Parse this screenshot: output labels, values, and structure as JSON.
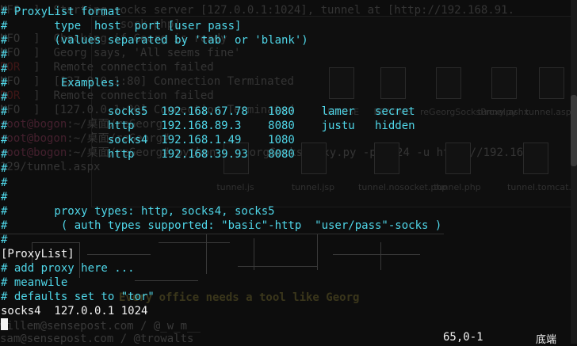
{
  "background_lines": [
    {
      "prefix": "NFO",
      "sep": "  ]  ",
      "text": "Starting socks server [127.0.0.1:1024], tunnel at [http://192.168.91."
    },
    {
      "prefix": "",
      "sep": "",
      "text": "                  sock.php]"
    },
    {
      "prefix": "NFO",
      "sep": "  ]  ",
      "text": "Checking if Georg is ready"
    },
    {
      "prefix": "NFO",
      "sep": "  ]  ",
      "text": "Georg says, 'All seems fine'"
    },
    {
      "prefix": "ROR",
      "sep": "  ]  ",
      "text": "Remote connection failed"
    },
    {
      "prefix": "NFO",
      "sep": "  ]  ",
      "text": "[127.0.0.1:80] Connection Terminated"
    },
    {
      "prefix": "ROR",
      "sep": "  ]  ",
      "text": "Remote connection failed"
    },
    {
      "prefix": "NFO",
      "sep": "  ]  ",
      "text": "[127.0.0.1:80] Connection Terminated"
    },
    {
      "prefix": "root@bogon",
      "sep": ":~/桌面/",
      "text": "reGeorg"
    },
    {
      "prefix": "root@bogon",
      "sep": ":~/桌面/",
      "text": "reGeorg#"
    },
    {
      "prefix": "root@bogon",
      "sep": ":~/桌面/",
      "text": "reGeorg# python reGeorgSocksProxy.py -p 1024 -u http://192.168"
    },
    {
      "prefix": "",
      "sep": "",
      "text": "129/tunnel.aspx"
    }
  ],
  "background_files": [
    "LICENSE",
    "README",
    "reGeorgSocksProxy.py",
    "tunnel.ashx",
    "tunnel.aspx",
    "tunnel.js",
    "tunnel.jsp",
    "tunnel.nosocket.php",
    "tunnel.php",
    "tunnel.tomcat.5.jsp"
  ],
  "background_banner": "Every office needs a tool like Georg",
  "background_credits": [
    "willem@sensepost.com / @_w_m__",
    "sam@sensepost.com / @trowalts"
  ],
  "lines": [
    {
      "text": "# ProxyList format",
      "color": "cyan"
    },
    {
      "text": "#       type  host  port [user pass]",
      "color": "cyan"
    },
    {
      "text": "#       (values separated by 'tab' or 'blank')",
      "color": "cyan"
    },
    {
      "text": "#",
      "color": "cyan"
    },
    {
      "text": "#",
      "color": "cyan"
    },
    {
      "text": "#        Examples:",
      "color": "cyan"
    },
    {
      "text": "#",
      "color": "cyan"
    },
    {
      "text": "#               socks5  192.168.67.78   1080    lamer   secret",
      "color": "cyan"
    },
    {
      "text": "#               http    192.168.89.3    8080    justu   hidden",
      "color": "cyan"
    },
    {
      "text": "#               socks4  192.168.1.49    1080",
      "color": "cyan"
    },
    {
      "text": "#               http    192.168.39.93   8080",
      "color": "cyan"
    },
    {
      "text": "#",
      "color": "cyan"
    },
    {
      "text": "#",
      "color": "cyan"
    },
    {
      "text": "#",
      "color": "cyan"
    },
    {
      "text": "#       proxy types: http, socks4, socks5",
      "color": "cyan"
    },
    {
      "text": "#        ( auth types supported: \"basic\"-http  \"user/pass\"-socks )",
      "color": "cyan"
    },
    {
      "text": "#",
      "color": "cyan"
    },
    {
      "text": "[ProxyList]",
      "color": "white"
    },
    {
      "text": "# add proxy here ...",
      "color": "cyan"
    },
    {
      "text": "# meanwile",
      "color": "cyan"
    },
    {
      "text": "# defaults set to \"tor\"",
      "color": "cyan"
    },
    {
      "text": "socks4  127.0.0.1 1024",
      "color": "white"
    }
  ],
  "status": {
    "position": "65,0-1",
    "scroll": "底端"
  },
  "colors": {
    "cyan": "#4fd6e8",
    "white": "#f2f2f2",
    "background": "#0d0d0d"
  }
}
